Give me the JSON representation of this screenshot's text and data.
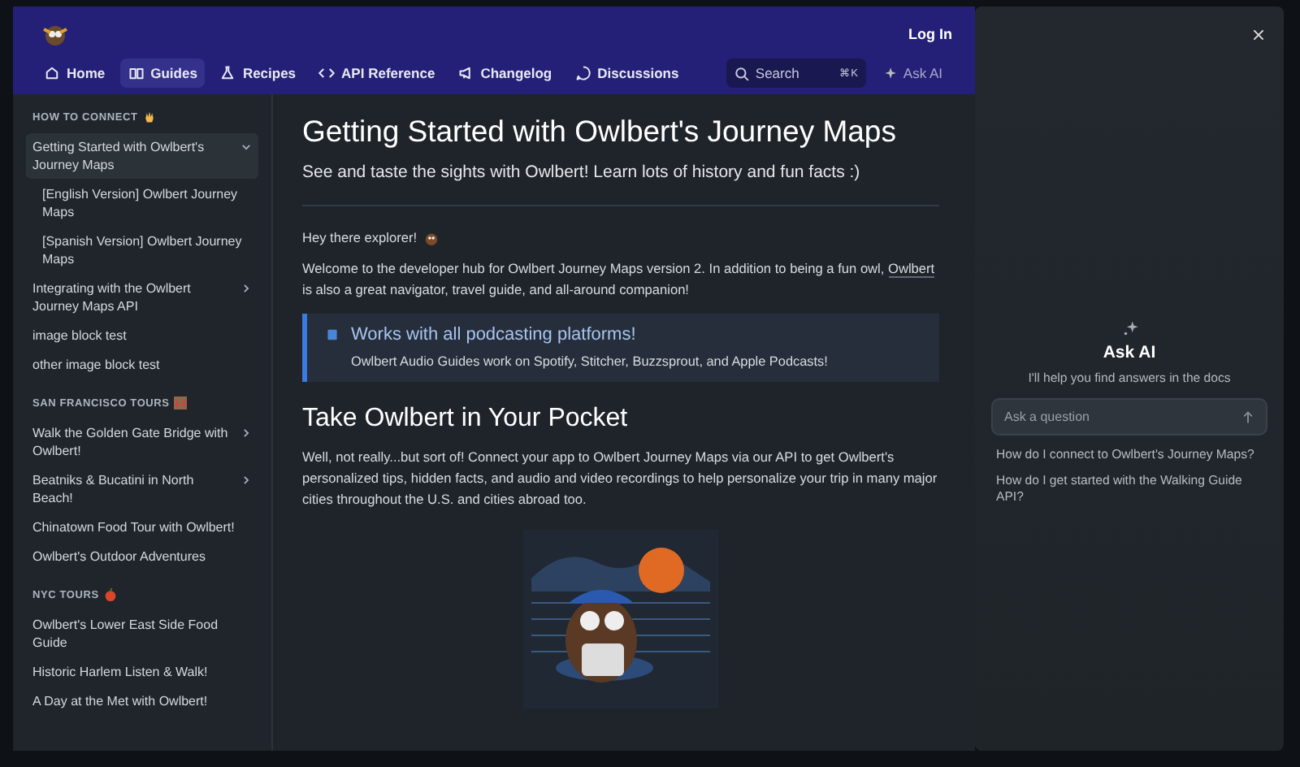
{
  "header": {
    "login": "Log In",
    "tabs": [
      {
        "label": "Home",
        "selected": false
      },
      {
        "label": "Guides",
        "selected": true
      },
      {
        "label": "Recipes",
        "selected": false
      },
      {
        "label": "API Reference",
        "selected": false
      },
      {
        "label": "Changelog",
        "selected": false
      },
      {
        "label": "Discussions",
        "selected": false
      }
    ],
    "search": {
      "placeholder": "Search",
      "shortcut": "⌘K"
    },
    "ask_ai": "Ask AI"
  },
  "sidebar": {
    "sections": [
      {
        "title": "HOW TO CONNECT",
        "items": [
          {
            "label": "Getting Started with Owlbert's Journey Maps",
            "selected": true,
            "expanded": true,
            "children": [
              {
                "label": "[English Version] Owlbert Journey Maps",
                "selected": false
              },
              {
                "label": "[Spanish Version] Owlbert Journey Maps",
                "selected": false
              }
            ]
          },
          {
            "label": "Integrating with the Owlbert Journey Maps API",
            "selected": false,
            "expanded": false
          },
          {
            "label": "image block test",
            "selected": false
          },
          {
            "label": "other image block test",
            "selected": false
          }
        ]
      },
      {
        "title": "SAN FRANCISCO TOURS",
        "items": [
          {
            "label": "Walk the Golden Gate Bridge with Owlbert!",
            "selected": false,
            "expanded": false
          },
          {
            "label": "Beatniks & Bucatini in North Beach!",
            "selected": false,
            "expanded": false
          },
          {
            "label": "Chinatown Food Tour with Owlbert!",
            "selected": false
          },
          {
            "label": "Owlbert's Outdoor Adventures",
            "selected": false
          }
        ]
      },
      {
        "title": "NYC TOURS",
        "items": [
          {
            "label": "Owlbert's Lower East Side Food Guide",
            "selected": false
          },
          {
            "label": "Historic Harlem Listen & Walk!",
            "selected": false
          },
          {
            "label": "A Day at the Met with Owlbert!",
            "selected": false
          }
        ]
      }
    ]
  },
  "article": {
    "title": "Getting Started with Owlbert's Journey Maps",
    "subtitle": "See and taste the sights with Owlbert! Learn lots of history and fun facts :)",
    "greeting": "Hey there explorer!",
    "intro_before": "Welcome to the developer hub for Owlbert Journey Maps version 2. In addition to being a fun owl,",
    "intro_link": "Owlbert",
    "intro_after": "is also a great navigator, travel guide, and all-around companion!",
    "callout": {
      "title": "Works with all podcasting platforms!",
      "body": "Owlbert Audio Guides work on Spotify, Stitcher, Buzzsprout, and Apple Podcasts!"
    },
    "heading": "Take Owlbert in Your Pocket",
    "paragraph": "Well, not really...but sort of! Connect your app to Owlbert Journey Maps via our API to get Owlbert's personalized tips, hidden facts, and audio and video recordings to help personalize your trip in many major cities throughout the U.S. and cities abroad too."
  },
  "ai_panel": {
    "title": "Ask AI",
    "subtitle": "I'll help you find answers in the docs",
    "input": {
      "placeholder": "Ask a question"
    },
    "suggestions": [
      "How do I connect to Owlbert's Journey Maps?",
      "How do I get started with the Walking Guide API?"
    ]
  }
}
